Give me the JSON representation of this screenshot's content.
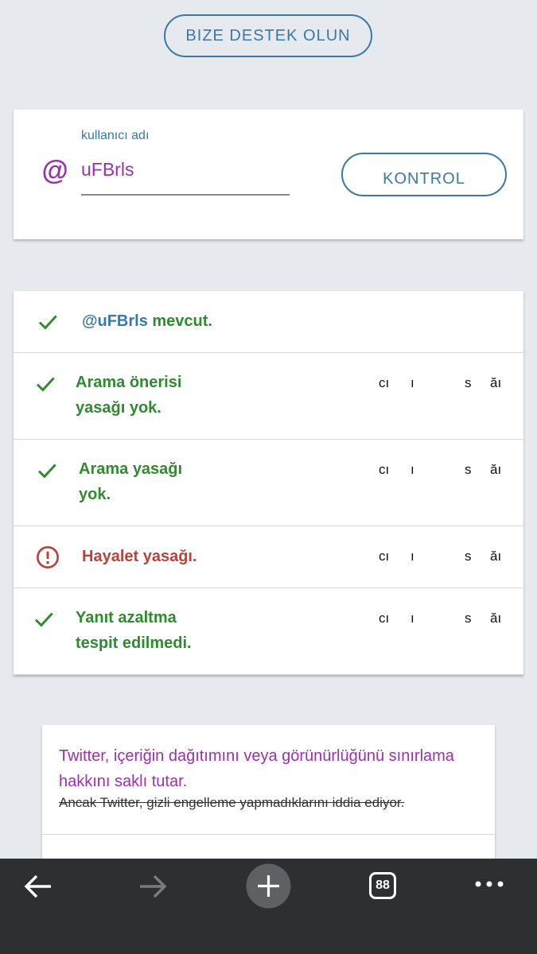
{
  "header": {
    "support_label": "BIZE DESTEK OLUN"
  },
  "username_form": {
    "at_symbol": "@",
    "label": "kullanıcı adı",
    "value": "uFBrls",
    "check_label": "KONTROL"
  },
  "results": {
    "exists": {
      "handle": "@uFBrls",
      "suffix": " mevcut."
    },
    "rows": [
      {
        "line1": "Arama önerisi",
        "line2": "yasağı yok.",
        "c1": "cı",
        "c2": "ı",
        "c3": "s",
        "c4": "ăı",
        "status": "ok"
      },
      {
        "line1": "Arama yasağı",
        "line2": "yok.",
        "c1": "cı",
        "c2": "ı",
        "c3": "s",
        "c4": "ăı",
        "status": "ok"
      },
      {
        "line1": "Hayalet yasağı.",
        "line2": "",
        "c1": "cı",
        "c2": "ı",
        "c3": "s",
        "c4": "ăı",
        "status": "warning"
      },
      {
        "line1": "Yanıt azaltma",
        "line2": "tespit edilmedi.",
        "c1": "cı",
        "c2": "ı",
        "c3": "s",
        "c4": "ăı",
        "status": "ok"
      }
    ]
  },
  "info": {
    "line1": "Twitter, içeriğin dağıtımını veya görünürlüğünü sınırlama hakkını saklı tutar.",
    "line2": "Ancak Twitter, gizli engelleme yapmadıklarını iddia ediyor."
  },
  "browser": {
    "tab_count": "88"
  },
  "colors": {
    "accent": "#3a78a8",
    "username": "#9c2fae",
    "ok": "#2e8b2e",
    "warning": "#b8433a"
  }
}
